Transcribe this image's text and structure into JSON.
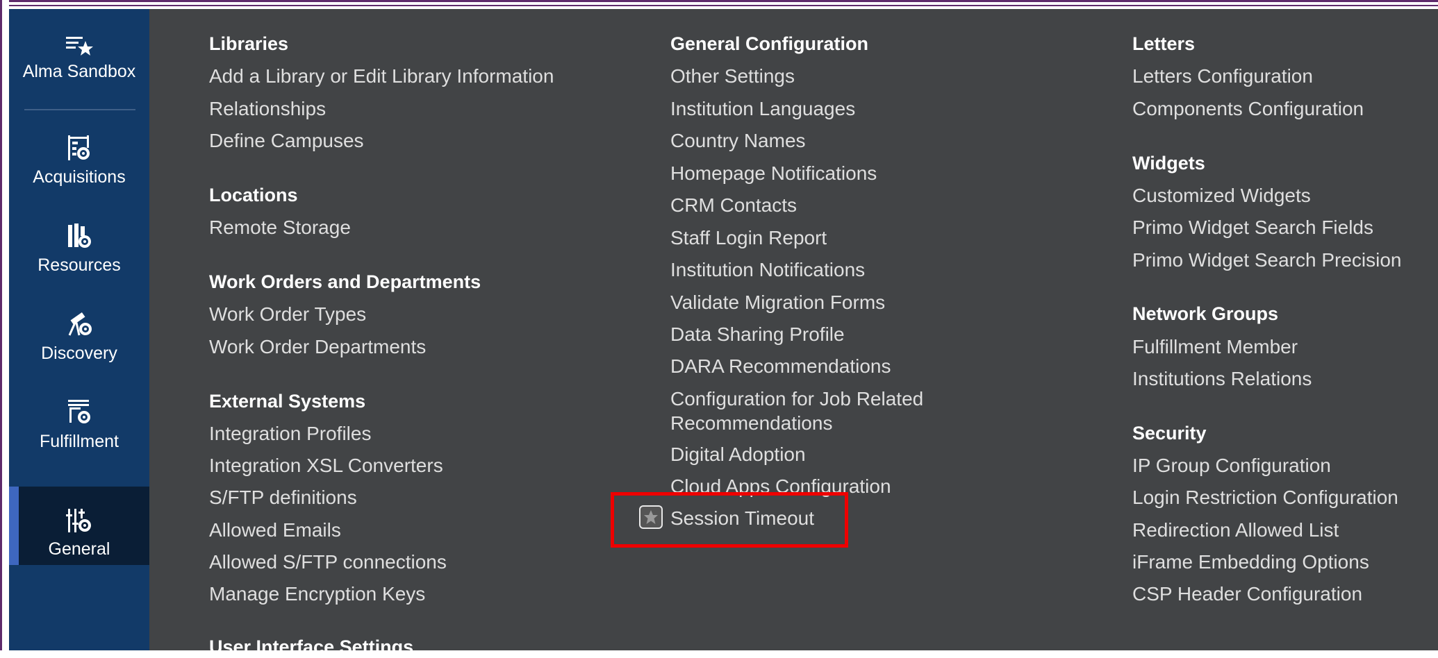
{
  "sidebar": {
    "items": [
      {
        "label": "Alma Sandbox",
        "icon": "sandbox-star-icon"
      },
      {
        "label": "Acquisitions",
        "icon": "acquisitions-icon"
      },
      {
        "label": "Resources",
        "icon": "resources-icon"
      },
      {
        "label": "Discovery",
        "icon": "discovery-icon"
      },
      {
        "label": "Fulfillment",
        "icon": "fulfillment-icon"
      },
      {
        "label": "General",
        "icon": "general-icon",
        "active": true
      }
    ]
  },
  "columns": [
    {
      "sections": [
        {
          "heading": "Libraries",
          "links": [
            "Add a Library or Edit Library Information",
            "Relationships",
            "Define Campuses"
          ]
        },
        {
          "heading": "Locations",
          "links": [
            "Remote Storage"
          ]
        },
        {
          "heading": "Work Orders and Departments",
          "links": [
            "Work Order Types",
            "Work Order Departments"
          ]
        },
        {
          "heading": "External Systems",
          "links": [
            "Integration Profiles",
            "Integration XSL Converters",
            "S/FTP definitions",
            "Allowed Emails",
            "Allowed S/FTP connections",
            "Manage Encryption Keys"
          ]
        },
        {
          "heading": "User Interface Settings",
          "links": []
        }
      ]
    },
    {
      "sections": [
        {
          "heading": "General Configuration",
          "links": [
            "Other Settings",
            "Institution Languages",
            "Country Names",
            "Homepage Notifications",
            "CRM Contacts",
            "Staff Login Report",
            "Institution Notifications",
            "Validate Migration Forms",
            "Data Sharing Profile",
            "DARA Recommendations",
            "Configuration for Job Related Recommendations",
            "Digital Adoption",
            "Cloud Apps Configuration",
            "Session Timeout"
          ]
        }
      ]
    },
    {
      "sections": [
        {
          "heading": "Letters",
          "links": [
            "Letters Configuration",
            "Components Configuration"
          ]
        },
        {
          "heading": "Widgets",
          "links": [
            "Customized Widgets",
            "Primo Widget Search Fields",
            "Primo Widget Search Precision"
          ]
        },
        {
          "heading": "Network Groups",
          "links": [
            "Fulfillment Member",
            "Institutions Relations"
          ]
        },
        {
          "heading": "Security",
          "links": [
            "IP Group Configuration",
            "Login Restriction Configuration",
            "Redirection Allowed List",
            "iFrame Embedding Options",
            "CSP Header Configuration"
          ]
        }
      ]
    }
  ],
  "highlight": {
    "target": "Session Timeout",
    "color": "#ee0000"
  },
  "colors": {
    "sidebar": "#123a68",
    "sidebar_active": "#0a1e36",
    "active_marker": "#3e67bf",
    "main_bg": "#424446",
    "frame": "#5e2a6b"
  }
}
